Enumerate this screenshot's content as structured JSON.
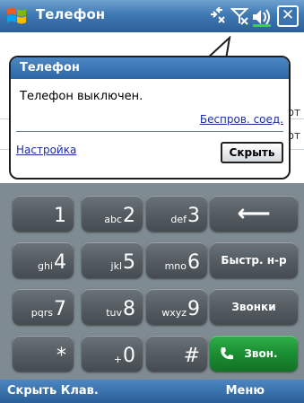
{
  "titlebar": {
    "title": "Телефон",
    "close_label": "✕"
  },
  "background": {
    "right_snippets": [
      "от",
      "от"
    ]
  },
  "popup": {
    "header": "Телефон",
    "message": "Телефон выключен.",
    "wireless_link": "Беспров. соед.",
    "settings_link": "Настройка",
    "hide_button": "Скрыть"
  },
  "keypad": {
    "rows": [
      [
        {
          "digit": "1",
          "letters": ""
        },
        {
          "digit": "2",
          "letters": "abc"
        },
        {
          "digit": "3",
          "letters": "def"
        }
      ],
      [
        {
          "digit": "4",
          "letters": "ghi"
        },
        {
          "digit": "5",
          "letters": "jkl"
        },
        {
          "digit": "6",
          "letters": "mno"
        }
      ],
      [
        {
          "digit": "7",
          "letters": "pqrs"
        },
        {
          "digit": "8",
          "letters": "tuv"
        },
        {
          "digit": "9",
          "letters": "wxyz"
        }
      ],
      [
        {
          "digit": "*",
          "letters": ""
        },
        {
          "digit": "0",
          "letters": "+"
        },
        {
          "digit": "#",
          "letters": ""
        }
      ]
    ],
    "backspace_label": "⟵",
    "speed_dial_label": "Быстр. н-р",
    "calls_label": "Звонки",
    "call_label": "Звон."
  },
  "softkeys": {
    "left": "Скрыть Клав.",
    "right": "Меню"
  },
  "colors": {
    "titlebar": "#3f79b4",
    "call_green": "#1a8d32",
    "link_blue": "#1a2ea8"
  }
}
